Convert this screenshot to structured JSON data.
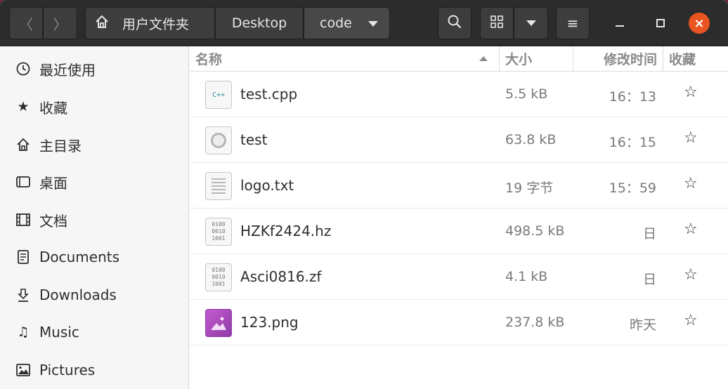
{
  "header": {
    "nav_back": "〈",
    "nav_forward": "〉",
    "breadcrumbs": [
      "用户文件夹",
      "Desktop",
      "code"
    ],
    "menu_icon": "≡",
    "close_glyph": "×"
  },
  "sidebar": {
    "items": [
      {
        "icon": "clock-icon",
        "glyph": "🕓",
        "label": "最近使用"
      },
      {
        "icon": "star-icon",
        "glyph": "★",
        "label": "收藏"
      },
      {
        "icon": "home-icon",
        "glyph": "⌂",
        "label": "主目录"
      },
      {
        "icon": "desktop-icon",
        "glyph": "▭",
        "label": "桌面"
      },
      {
        "icon": "film-icon",
        "glyph": "🎞",
        "label": "文档"
      },
      {
        "icon": "document-icon",
        "glyph": "🗎",
        "label": "Documents"
      },
      {
        "icon": "download-icon",
        "glyph": "⇩",
        "label": "Downloads"
      },
      {
        "icon": "music-icon",
        "glyph": "♫",
        "label": "Music"
      },
      {
        "icon": "picture-icon",
        "glyph": "🖼",
        "label": "Pictures"
      }
    ]
  },
  "columns": {
    "name": "名称",
    "size": "大小",
    "modified": "修改时间",
    "starred": "收藏"
  },
  "files": [
    {
      "name": "test.cpp",
      "size": "5.5 kB",
      "modified": "16：13",
      "type": "cpp",
      "icon_text": "C++"
    },
    {
      "name": "test",
      "size": "63.8 kB",
      "modified": "16：15",
      "type": "exec"
    },
    {
      "name": "logo.txt",
      "size": "19 字节",
      "modified": "15：59",
      "type": "txt"
    },
    {
      "name": "HZKf2424.hz",
      "size": "498.5 kB",
      "modified": "日",
      "type": "bin",
      "icon_text": "0100\n0010\n1001"
    },
    {
      "name": "Asci0816.zf",
      "size": "4.1 kB",
      "modified": "日",
      "type": "bin",
      "icon_text": "0100\n0010\n1001"
    },
    {
      "name": "123.png",
      "size": "237.8 kB",
      "modified": "昨天",
      "type": "png"
    }
  ],
  "star_glyph": "☆",
  "colors": {
    "close_button": "#e95420",
    "headerbar": "#2c2c2c",
    "png_icon": "#b04cc4"
  }
}
